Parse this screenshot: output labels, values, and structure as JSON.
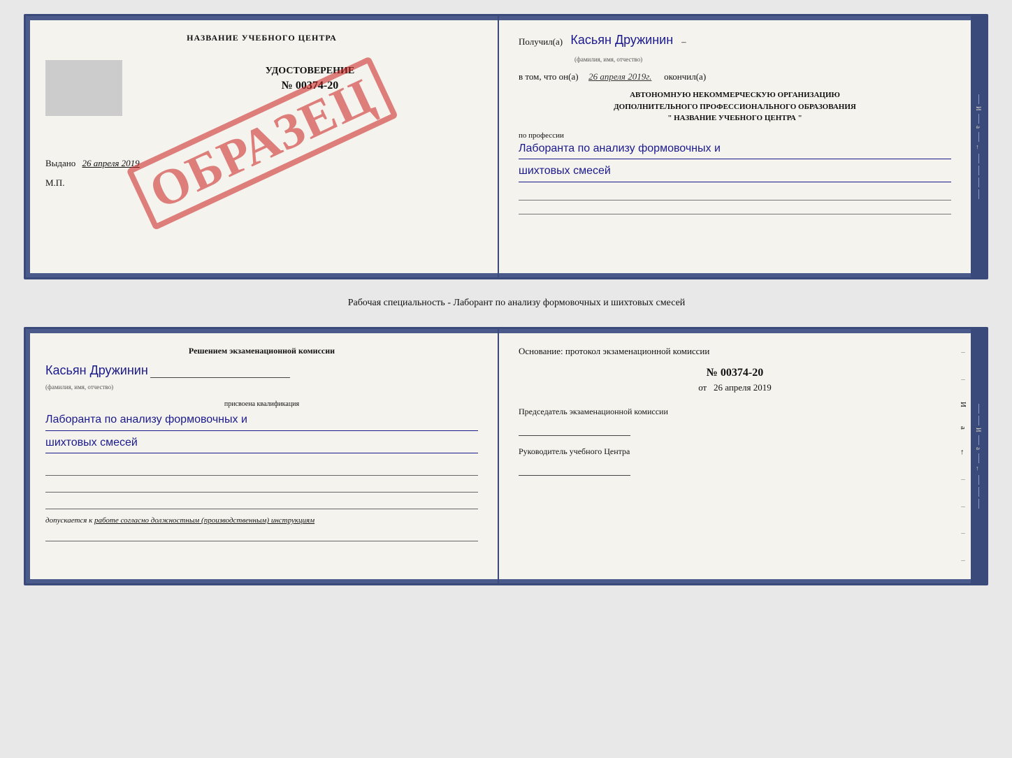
{
  "top_card": {
    "left": {
      "title": "НАЗВАНИЕ УЧЕБНОГО ЦЕНТРА",
      "cert_label": "УДОСТОВЕРЕНИЕ",
      "cert_number": "№ 00374-20",
      "vydano_label": "Выдано",
      "vydano_date": "26 апреля 2019",
      "mp_label": "М.П.",
      "stamp_text": "ОБРАЗЕЦ"
    },
    "right": {
      "poluchil_label": "Получил(a)",
      "recipient_name": "Касьян Дружинин",
      "fio_sublabel": "(фамилия, имя, отчество)",
      "vtom_label": "в том, что он(а)",
      "date_value": "26 апреля 2019г.",
      "okonchil_label": "окончил(а)",
      "org_line1": "АВТОНОМНУЮ НЕКОММЕРЧЕСКУЮ ОРГАНИЗАЦИЮ",
      "org_line2": "ДОПОЛНИТЕЛЬНОГО ПРОФЕССИОНАЛЬНОГО ОБРАЗОВАНИЯ",
      "org_line3": "\"  НАЗВАНИЕ УЧЕБНОГО ЦЕНТРА  \"",
      "po_professii_label": "по профессии",
      "profession_handwritten_line1": "Лаборанта по анализу формовочных и",
      "profession_handwritten_line2": "шихтовых смесей"
    }
  },
  "specialty_line": "Рабочая специальность - Лаборант по анализу формовочных и шихтовых смесей",
  "bottom_card": {
    "left": {
      "resheniem_label": "Решением экзаменационной комиссии",
      "name_handwritten": "Касьян Дружинин",
      "fio_sublabel": "(фамилия, имя, отчество)",
      "prisvoena_label": "присвоена квалификация",
      "qualification_line1": "Лаборанта по анализу формовочных и",
      "qualification_line2": "шихтовых смесей",
      "dopusk_label": "допускается к",
      "dopusk_text": "работе согласно должностным (производственным) инструкциям"
    },
    "right": {
      "osnovanie_label": "Основание: протокол экзаменационной комиссии",
      "protocol_number": "№ 00374-20",
      "ot_label": "от",
      "date_value": "26 апреля 2019",
      "predsedatel_label": "Председатель экзаменационной комиссии",
      "rukovoditel_label": "Руководитель учебного Центра"
    }
  }
}
